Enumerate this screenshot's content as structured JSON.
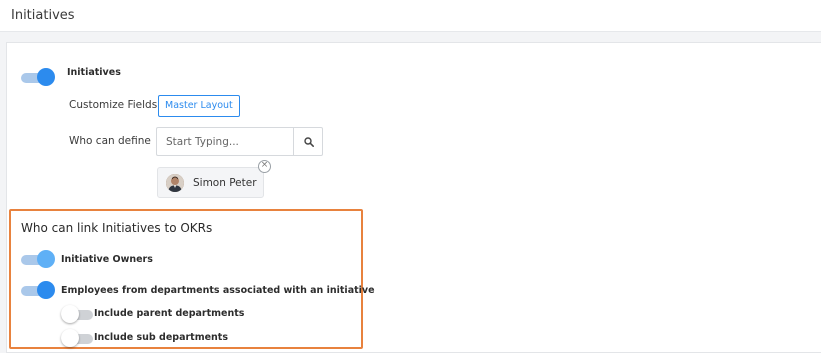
{
  "header": {
    "title": "Initiatives"
  },
  "initiatives": {
    "toggle_label": "Initiatives",
    "toggle_on": true,
    "customize_fields_label": "Customize Fields",
    "master_layout_button": "Master Layout",
    "who_can_define_label": "Who can define",
    "search": {
      "placeholder": "Start Typing...",
      "value": ""
    },
    "selected_users": [
      {
        "name": "Simon Peter"
      }
    ]
  },
  "link_section": {
    "title": "Who can link Initiatives to OKRs",
    "options": [
      {
        "label": "Initiative Owners",
        "on": true
      },
      {
        "label": "Employees from departments associated with an initiative",
        "on": true
      },
      {
        "label": "Include parent departments",
        "on": false
      },
      {
        "label": "Include sub departments",
        "on": false
      }
    ]
  },
  "colors": {
    "accent": "#2c8bee",
    "highlight_border": "#e8823e"
  },
  "icons": [
    "search-icon",
    "close-icon",
    "avatar"
  ]
}
